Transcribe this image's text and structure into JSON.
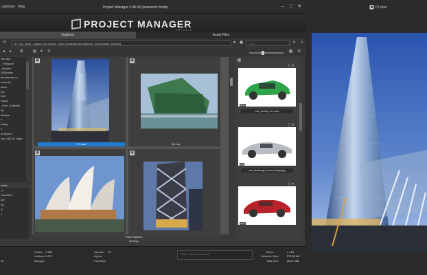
{
  "menu": {
    "items": [
      "ustomize",
      "Help"
    ]
  },
  "window": {
    "title": "Project Manager 3.08.00 (teamwork mode)"
  },
  "logo": {
    "text": "PROJECT MANAGER",
    "subtitle": "KSTUDIO"
  },
  "tabs": [
    {
      "label": "Explorer",
      "active": true
    },
    {
      "label": "Asset Files",
      "active": false
    }
  ],
  "path": {
    "value": "H:\\7 My_Work \\_Major\\_3d models \\_Best_Models\\Evermotion\\52_Archmodels_Building"
  },
  "filter": {
    "placeholder": "Filter"
  },
  "tree": {
    "items": [
      "Tehnika",
      "_Transport",
      "_Models",
      "3DModels",
      "ree domain.ru",
      "ownload",
      "ssion",
      "ors",
      "odo",
      "",
      "estals",
      "_Free_Collectio",
      "3D",
      "Models",
      "s",
      "urting",
      "",
      "e",
      "&Flowers",
      "",
      "",
      "",
      "own 360.30 Objec",
      ""
    ]
  },
  "favorites": {
    "header": "orites",
    "items": [
      "_e",
      "Favorites",
      "",
      "ure",
      "ng",
      "D",
      "",
      "d"
    ]
  },
  "grid": {
    "items": [
      {
        "label": "07.max",
        "selected": true
      },
      {
        "label": "08.max",
        "selected": false
      },
      {
        "label": "",
        "selected": false
      },
      {
        "label": "",
        "selected": false
      }
    ],
    "footer_options": "Place Options",
    "footer_settings": "Settings"
  },
  "assets": {
    "items": [
      {
        "ext": "max",
        "label": "car_skoda_fox.max"
      },
      {
        "ext": "jpg",
        "label": "car_lamborghi_murcielago.jpg"
      },
      {
        "ext": "max",
        "label": ""
      }
    ]
  },
  "status": {
    "faces_label": "Faces:",
    "faces_value": "1 394",
    "vertices_label": "Vertices:",
    "vertices_value": "1 671",
    "bitmaps_label": "Bitmaps:",
    "objects_label": "Objects:",
    "objects_value": "15",
    "lights_label": "Lights:",
    "favorites_label": "Favorites:",
    "left_value": "19",
    "todo_placeholder": "TODO: Add environment",
    "items_label": "Items:",
    "items_value": "1 / 64",
    "selsize_label": "Selection Size:",
    "selsize_value": "572.09 kB",
    "totalsize_label": "Total Size:",
    "totalsize_value": "26.47 MB"
  },
  "preview": {
    "title": "07.max"
  },
  "colors": {
    "selection": "#1e7bd1",
    "panel": "#3a3a3a",
    "sky": "#3d66b8"
  }
}
